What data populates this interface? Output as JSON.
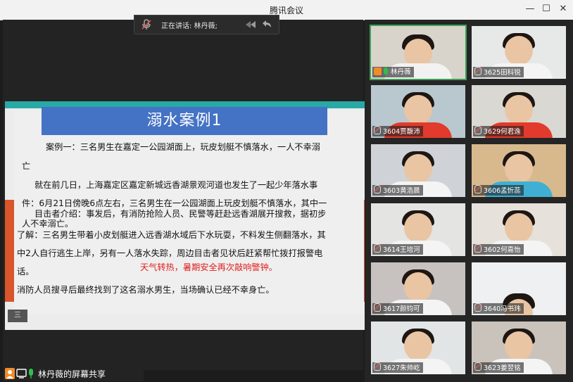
{
  "window": {
    "title": "腾讯会议",
    "minimize": "—",
    "maximize": "☐",
    "close": "✕"
  },
  "speaking_banner": {
    "label": "正在讲话: 林丹薇;"
  },
  "slide": {
    "title": "溺水案例1",
    "lines": [
      "案例一：三名男生在嘉定一公园湖面上，玩皮划艇不慎落水，一人不幸溺",
      "亡",
      "就在前几日，上海嘉定区嘉定新城远香湖景观河道也发生了一起少年落水事",
      "件：6月21日傍晚6点左右，三名男生在一公园湖面上玩皮划艇不慎落水，其中一",
      "目击者介绍：事发后，有消防抢险人员、民警等赶赴远香湖展开搜救，据初步",
      "人不幸溺亡。",
      "了解：三名男生带着小皮划艇进入远香湖水域后下水玩耍，不料发生侧翻落水，其",
      "中2人自行逃生上岸，另有一人落水失踪，周边目击者见状后赶紧帮忙拨打报警电",
      "话。",
      "天气转热，暑期安全再次敲响警钟。",
      "消防人员搜寻后最终找到了这名溺水男生，当场确认已经不幸身亡。"
    ],
    "strip_label": "三"
  },
  "participants": [
    {
      "name": "林丹薇",
      "host": true,
      "mic": "on",
      "bg": "#d9d4cb"
    },
    {
      "name": "3625田科锐",
      "host": false,
      "mic": "muted",
      "bg": "#e7e9e8"
    },
    {
      "name": "3604贾馥沛",
      "host": false,
      "mic": "muted",
      "bg": "#b9c7cf"
    },
    {
      "name": "3629何君逸",
      "host": false,
      "mic": "muted",
      "bg": "#d9d8d2"
    },
    {
      "name": "3603黄浩晨",
      "host": false,
      "mic": "muted",
      "bg": "#cfd2d6"
    },
    {
      "name": "3606孟忻蕊",
      "host": false,
      "mic": "muted",
      "bg": "#d8b98e"
    },
    {
      "name": "3614王培河",
      "host": false,
      "mic": "muted",
      "bg": "#e4e4e2"
    },
    {
      "name": "3602何嘉怡",
      "host": false,
      "mic": "muted",
      "bg": "#e6e2db"
    },
    {
      "name": "3617颜钧可",
      "host": false,
      "mic": "muted",
      "bg": "#c7c2bf"
    },
    {
      "name": "3640冯书玮",
      "host": false,
      "mic": "muted",
      "bg": "#eef0f1"
    },
    {
      "name": "3627朱帅屹",
      "host": false,
      "mic": "muted",
      "bg": "#e2e5e6"
    },
    {
      "name": "3623姜翌铭",
      "host": false,
      "mic": "muted",
      "bg": "#c9c3bb"
    }
  ],
  "share_status": {
    "label": "林丹薇的屏幕共享"
  },
  "colors": {
    "slide_title_bg": "#4472c4",
    "teal_bar": "#29a9a5",
    "orange_band": "#d9562c",
    "warning_text": "#e01f1f",
    "active_speaker": "#3aa356"
  }
}
